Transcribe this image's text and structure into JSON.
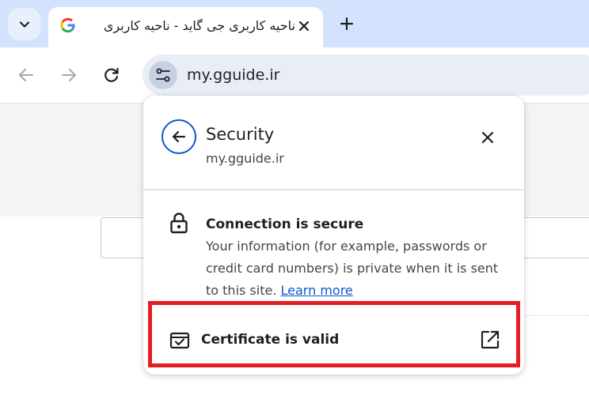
{
  "tab": {
    "title": "ناحیه کاربری جی گاید - ناحیه کاربری",
    "favicon": "google-g-icon"
  },
  "toolbar": {
    "url": "my.gguide.ir"
  },
  "security_popup": {
    "title": "Security",
    "subtitle": "my.gguide.ir",
    "connection_title": "Connection is secure",
    "connection_desc": "Your information (for example, passwords or credit card numbers) is private when it is sent to this site.",
    "learn_more": "Learn more",
    "certificate_label": "Certificate is valid"
  },
  "colors": {
    "accent": "#0b57d0",
    "highlight": "#e31e24",
    "tabstrip": "#d3e3fd"
  }
}
